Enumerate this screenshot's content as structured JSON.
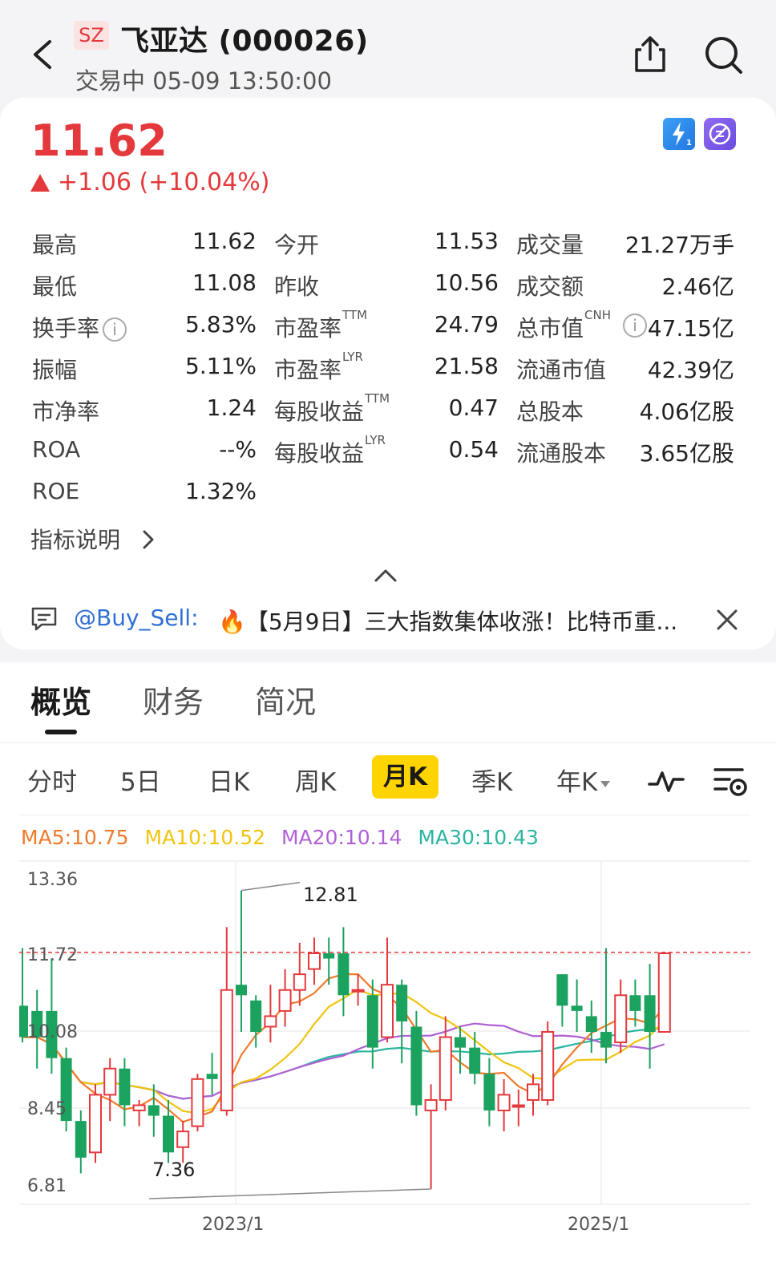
{
  "header": {
    "market": "SZ",
    "title": "飞亚达 (000026)",
    "status": "交易中 05-09 13:50:00"
  },
  "quote": {
    "price": "11.62",
    "change": "+1.06 (+10.04%)",
    "stats_left": [
      {
        "label": "最高",
        "value": "11.62"
      },
      {
        "label": "最低",
        "value": "11.08"
      },
      {
        "label": "换手率",
        "value": "5.83%",
        "info": true
      },
      {
        "label": "振幅",
        "value": "5.11%"
      },
      {
        "label": "市净率",
        "value": "1.24"
      },
      {
        "label": "ROA",
        "value": "--%"
      },
      {
        "label": "ROE",
        "value": "1.32%"
      }
    ],
    "stats_mid": [
      {
        "label": "今开",
        "sup": "",
        "value": "11.53"
      },
      {
        "label": "昨收",
        "sup": "",
        "value": "10.56"
      },
      {
        "label": "市盈率",
        "sup": "TTM",
        "value": "24.79"
      },
      {
        "label": "市盈率",
        "sup": "LYR",
        "value": "21.58"
      },
      {
        "label": "每股收益",
        "sup": "TTM",
        "value": "0.47"
      },
      {
        "label": "每股收益",
        "sup": "LYR",
        "value": "0.54"
      }
    ],
    "stats_right": [
      {
        "label": "成交量",
        "sup": "",
        "value": "21.27万手"
      },
      {
        "label": "成交额",
        "sup": "",
        "value": "2.46亿"
      },
      {
        "label": "总市值",
        "sup": "CNH",
        "value": "47.15亿",
        "info": true
      },
      {
        "label": "流通市值",
        "sup": "",
        "value": "42.39亿"
      },
      {
        "label": "总股本",
        "sup": "",
        "value": "4.06亿股"
      },
      {
        "label": "流通股本",
        "sup": "",
        "value": "3.65亿股"
      }
    ],
    "indicator_link": "指标说明"
  },
  "news": {
    "user": "@Buy_Sell:",
    "text": "🔥【5月9日】三大指数集体收涨！比特币重..."
  },
  "tabs": [
    "概览",
    "财务",
    "简况"
  ],
  "periods": [
    "分时",
    "5日",
    "日K",
    "周K",
    "月K",
    "季K",
    "年K"
  ],
  "active_period": "月K",
  "ma": {
    "ma5": "MA5:10.75",
    "ma10": "MA10:10.52",
    "ma20": "MA20:10.14",
    "ma30": "MA30:10.43",
    "colors": {
      "ma5": "#f07a2a",
      "ma10": "#f1c40f",
      "ma20": "#b061d6",
      "ma30": "#2bb5a0"
    }
  },
  "colors": {
    "up": "#e4393c",
    "down": "#1aa25e",
    "accent": "#ffd400"
  },
  "chart_data": {
    "type": "candlestick",
    "y_labels": [
      "13.36",
      "11.72",
      "10.08",
      "8.45",
      "6.81"
    ],
    "ylim": [
      6.81,
      13.36
    ],
    "x_labels": [
      "2023/1",
      "2025/1"
    ],
    "max_label": "12.81",
    "min_label": "7.36",
    "last_price": 11.62,
    "candles": [
      [
        10.6,
        10.0,
        11.7,
        9.9
      ],
      [
        10.5,
        10.0,
        10.9,
        9.4
      ],
      [
        10.5,
        9.6,
        11.5,
        9.3
      ],
      [
        9.6,
        8.4,
        9.8,
        8.2
      ],
      [
        8.4,
        7.7,
        8.6,
        7.4
      ],
      [
        7.8,
        8.9,
        9.1,
        7.6
      ],
      [
        8.9,
        9.4,
        9.6,
        8.4
      ],
      [
        9.4,
        8.7,
        9.6,
        8.3
      ],
      [
        8.6,
        8.7,
        8.8,
        8.3
      ],
      [
        8.7,
        8.5,
        9.1,
        8.1
      ],
      [
        8.5,
        7.8,
        8.8,
        7.6
      ],
      [
        7.9,
        8.2,
        8.4,
        7.6
      ],
      [
        8.3,
        9.2,
        9.3,
        8.2
      ],
      [
        9.3,
        9.2,
        9.7,
        8.9
      ],
      [
        8.6,
        10.9,
        12.1,
        8.5
      ],
      [
        11.0,
        10.8,
        12.8,
        10.1
      ],
      [
        10.7,
        10.1,
        10.8,
        9.8
      ],
      [
        10.2,
        10.4,
        11.0,
        9.9
      ],
      [
        10.5,
        10.9,
        11.3,
        10.2
      ],
      [
        10.9,
        11.2,
        11.8,
        10.6
      ],
      [
        11.3,
        11.6,
        11.9,
        11.0
      ],
      [
        11.6,
        11.5,
        11.9,
        11.0
      ],
      [
        11.6,
        10.8,
        12.1,
        10.4
      ],
      [
        10.9,
        10.9,
        11.2,
        10.6
      ],
      [
        10.8,
        9.8,
        11.1,
        9.4
      ],
      [
        10.0,
        11.0,
        11.9,
        9.9
      ],
      [
        11.0,
        10.3,
        11.1,
        9.5
      ],
      [
        10.2,
        8.7,
        10.5,
        8.5
      ],
      [
        8.6,
        8.8,
        9.1,
        7.1
      ],
      [
        8.8,
        10.0,
        10.4,
        8.6
      ],
      [
        10.0,
        9.8,
        10.2,
        9.3
      ],
      [
        9.8,
        9.3,
        10.1,
        9.1
      ],
      [
        9.3,
        8.6,
        9.6,
        8.3
      ],
      [
        8.6,
        8.9,
        9.2,
        8.2
      ],
      [
        8.7,
        8.7,
        9.0,
        8.3
      ],
      [
        8.8,
        9.1,
        9.3,
        8.5
      ],
      [
        8.8,
        10.1,
        10.3,
        8.7
      ],
      [
        11.2,
        10.6,
        11.2,
        10.2
      ],
      [
        10.6,
        10.5,
        11.1,
        10.1
      ],
      [
        10.4,
        10.1,
        10.7,
        9.7
      ],
      [
        10.1,
        9.8,
        11.7,
        9.5
      ],
      [
        9.9,
        10.8,
        11.1,
        9.7
      ],
      [
        10.8,
        10.5,
        11.1,
        10.2
      ],
      [
        10.8,
        10.1,
        11.4,
        9.4
      ],
      [
        10.1,
        11.6,
        11.6,
        10.1
      ]
    ]
  }
}
